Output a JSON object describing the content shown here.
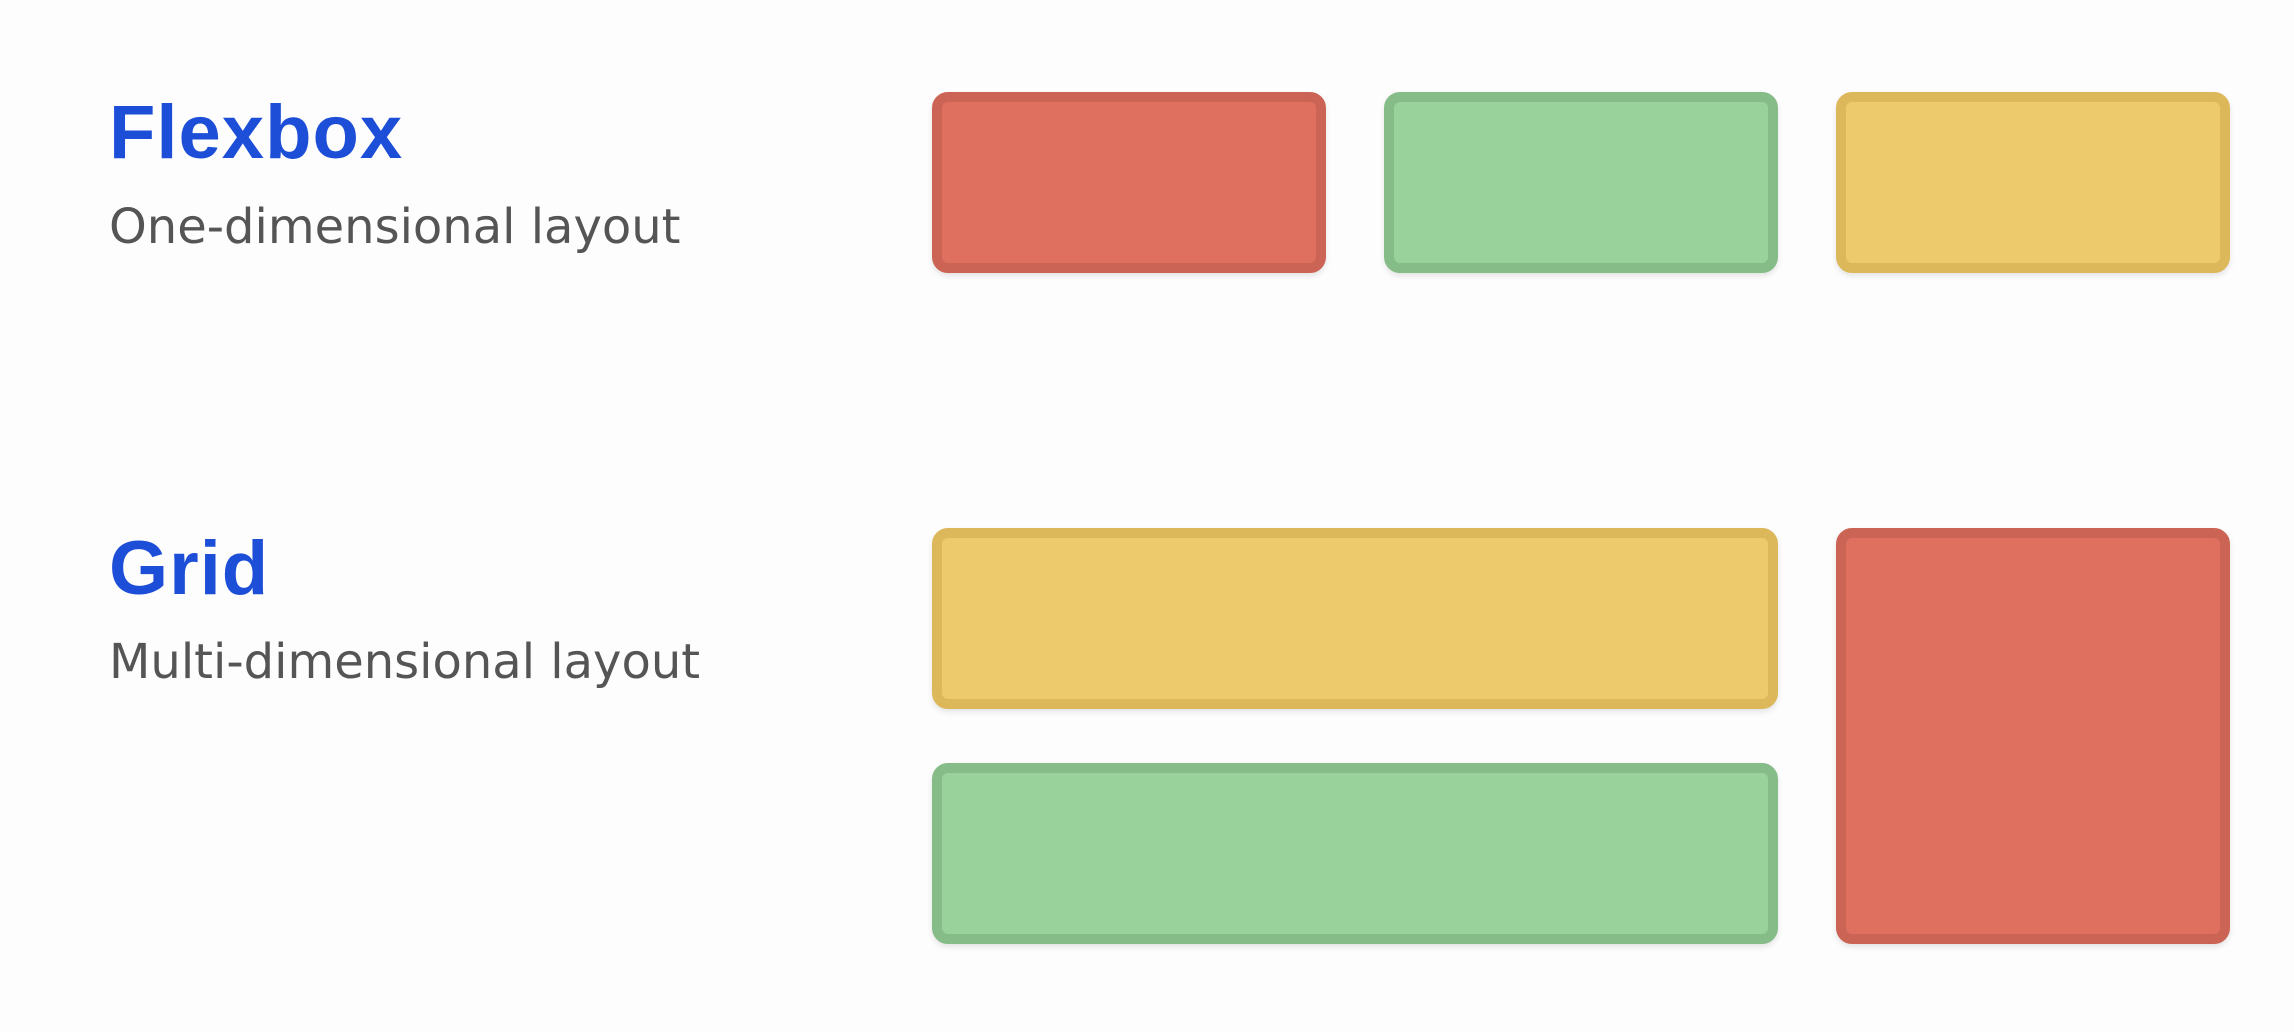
{
  "flexbox": {
    "title": "Flexbox",
    "subtitle": "One-dimensional layout",
    "boxes": [
      "red",
      "green",
      "yellow"
    ]
  },
  "grid": {
    "title": "Grid",
    "subtitle": "Multi-dimensional layout",
    "boxes": [
      "yellow",
      "green",
      "red"
    ]
  },
  "colors": {
    "title": "#1d4ed8",
    "subtitle": "#555555",
    "red": "#df705f",
    "green": "#99d29b",
    "yellow": "#edcb6d"
  }
}
